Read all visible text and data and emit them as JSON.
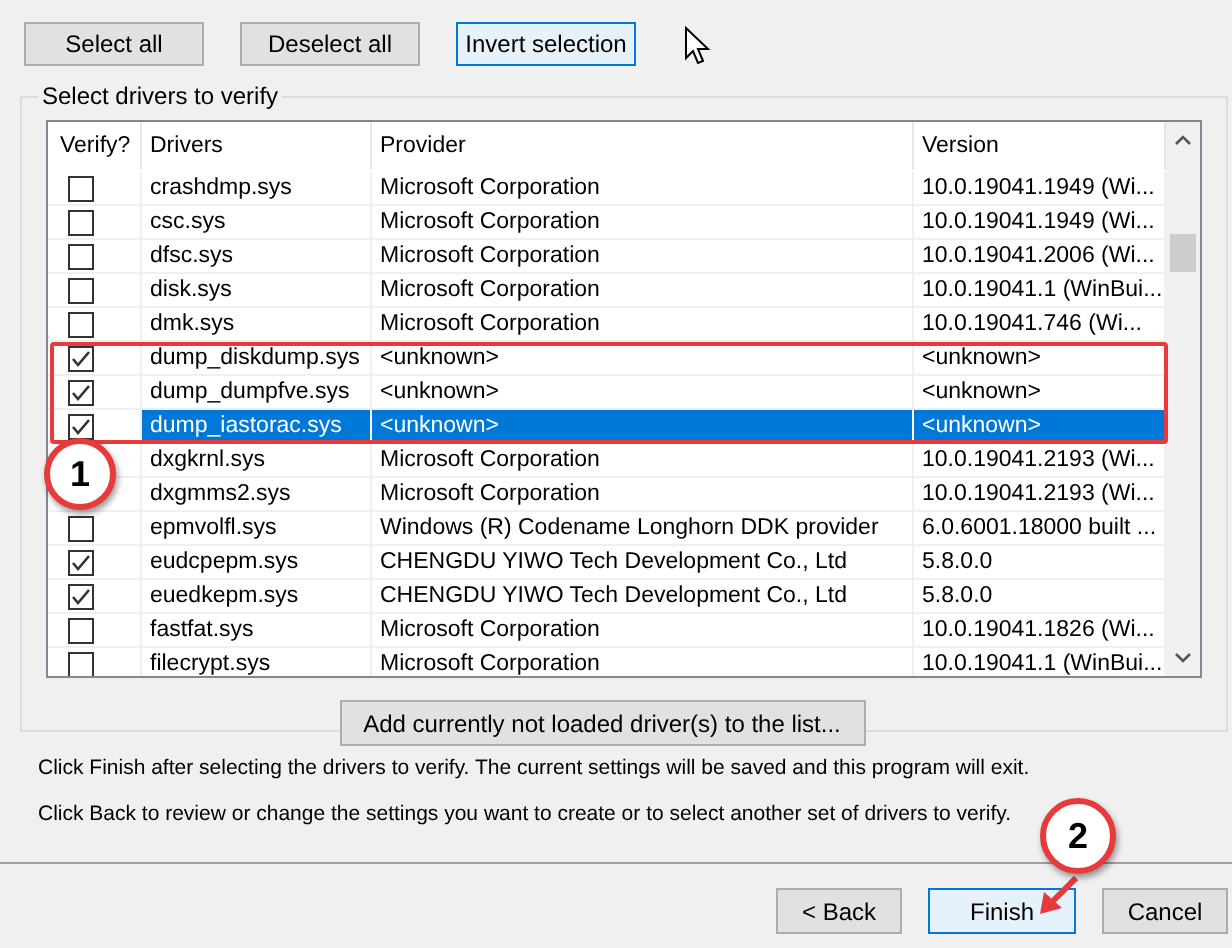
{
  "top_buttons": [
    {
      "label": "Select all",
      "focused": false
    },
    {
      "label": "Deselect all",
      "focused": false
    },
    {
      "label": "Invert selection",
      "focused": true
    }
  ],
  "group": {
    "title": "Select drivers to verify"
  },
  "table": {
    "columns": [
      "Verify?",
      "Drivers",
      "Provider",
      "Version"
    ],
    "rows": [
      {
        "checked": false,
        "selected": false,
        "driver": "crashdmp.sys",
        "provider": "Microsoft Corporation",
        "version": "10.0.19041.1949 (Wi..."
      },
      {
        "checked": false,
        "selected": false,
        "driver": "csc.sys",
        "provider": "Microsoft Corporation",
        "version": "10.0.19041.1949 (Wi..."
      },
      {
        "checked": false,
        "selected": false,
        "driver": "dfsc.sys",
        "provider": "Microsoft Corporation",
        "version": "10.0.19041.2006 (Wi..."
      },
      {
        "checked": false,
        "selected": false,
        "driver": "disk.sys",
        "provider": "Microsoft Corporation",
        "version": "10.0.19041.1 (WinBui..."
      },
      {
        "checked": false,
        "selected": false,
        "driver": "dmk.sys",
        "provider": "Microsoft Corporation",
        "version": "10.0.19041.746 (Wi..."
      },
      {
        "checked": true,
        "selected": false,
        "driver": "dump_diskdump.sys",
        "provider": "<unknown>",
        "version": "<unknown>"
      },
      {
        "checked": true,
        "selected": false,
        "driver": "dump_dumpfve.sys",
        "provider": "<unknown>",
        "version": "<unknown>"
      },
      {
        "checked": true,
        "selected": true,
        "driver": "dump_iastorac.sys",
        "provider": "<unknown>",
        "version": "<unknown>"
      },
      {
        "selected": false,
        "driver": "dxgkrnl.sys",
        "provider": "Microsoft Corporation",
        "version": "10.0.19041.2193 (Wi..."
      },
      {
        "selected": false,
        "driver": "dxgmms2.sys",
        "provider": "Microsoft Corporation",
        "version": "10.0.19041.2193 (Wi..."
      },
      {
        "checked": false,
        "selected": false,
        "driver": "epmvolfl.sys",
        "provider": "Windows (R) Codename Longhorn DDK provider",
        "version": "6.0.6001.18000 built ..."
      },
      {
        "checked": true,
        "selected": false,
        "driver": "eudcpepm.sys",
        "provider": "CHENGDU YIWO Tech Development Co., Ltd",
        "version": "5.8.0.0"
      },
      {
        "checked": true,
        "selected": false,
        "driver": "euedkepm.sys",
        "provider": "CHENGDU YIWO Tech Development Co., Ltd",
        "version": "5.8.0.0"
      },
      {
        "checked": false,
        "selected": false,
        "driver": "fastfat.sys",
        "provider": "Microsoft Corporation",
        "version": "10.0.19041.1826 (Wi..."
      },
      {
        "checked": false,
        "selected": false,
        "driver": "filecrypt.sys",
        "provider": "Microsoft Corporation",
        "version": "10.0.19041.1 (WinBui..."
      }
    ]
  },
  "add_button": "Add currently not loaded driver(s) to the list...",
  "info": [
    "Click Finish after selecting the drivers to verify. The current settings will be saved and this program will exit.",
    "Click Back to review or change the settings you want to create or to select another set of drivers to verify."
  ],
  "bottom_buttons": [
    {
      "label": "< Back",
      "focused": false
    },
    {
      "label": "Finish",
      "focused": true
    },
    {
      "label": "Cancel",
      "focused": false
    }
  ],
  "annotations": [
    {
      "label": "1"
    },
    {
      "label": "2"
    }
  ]
}
